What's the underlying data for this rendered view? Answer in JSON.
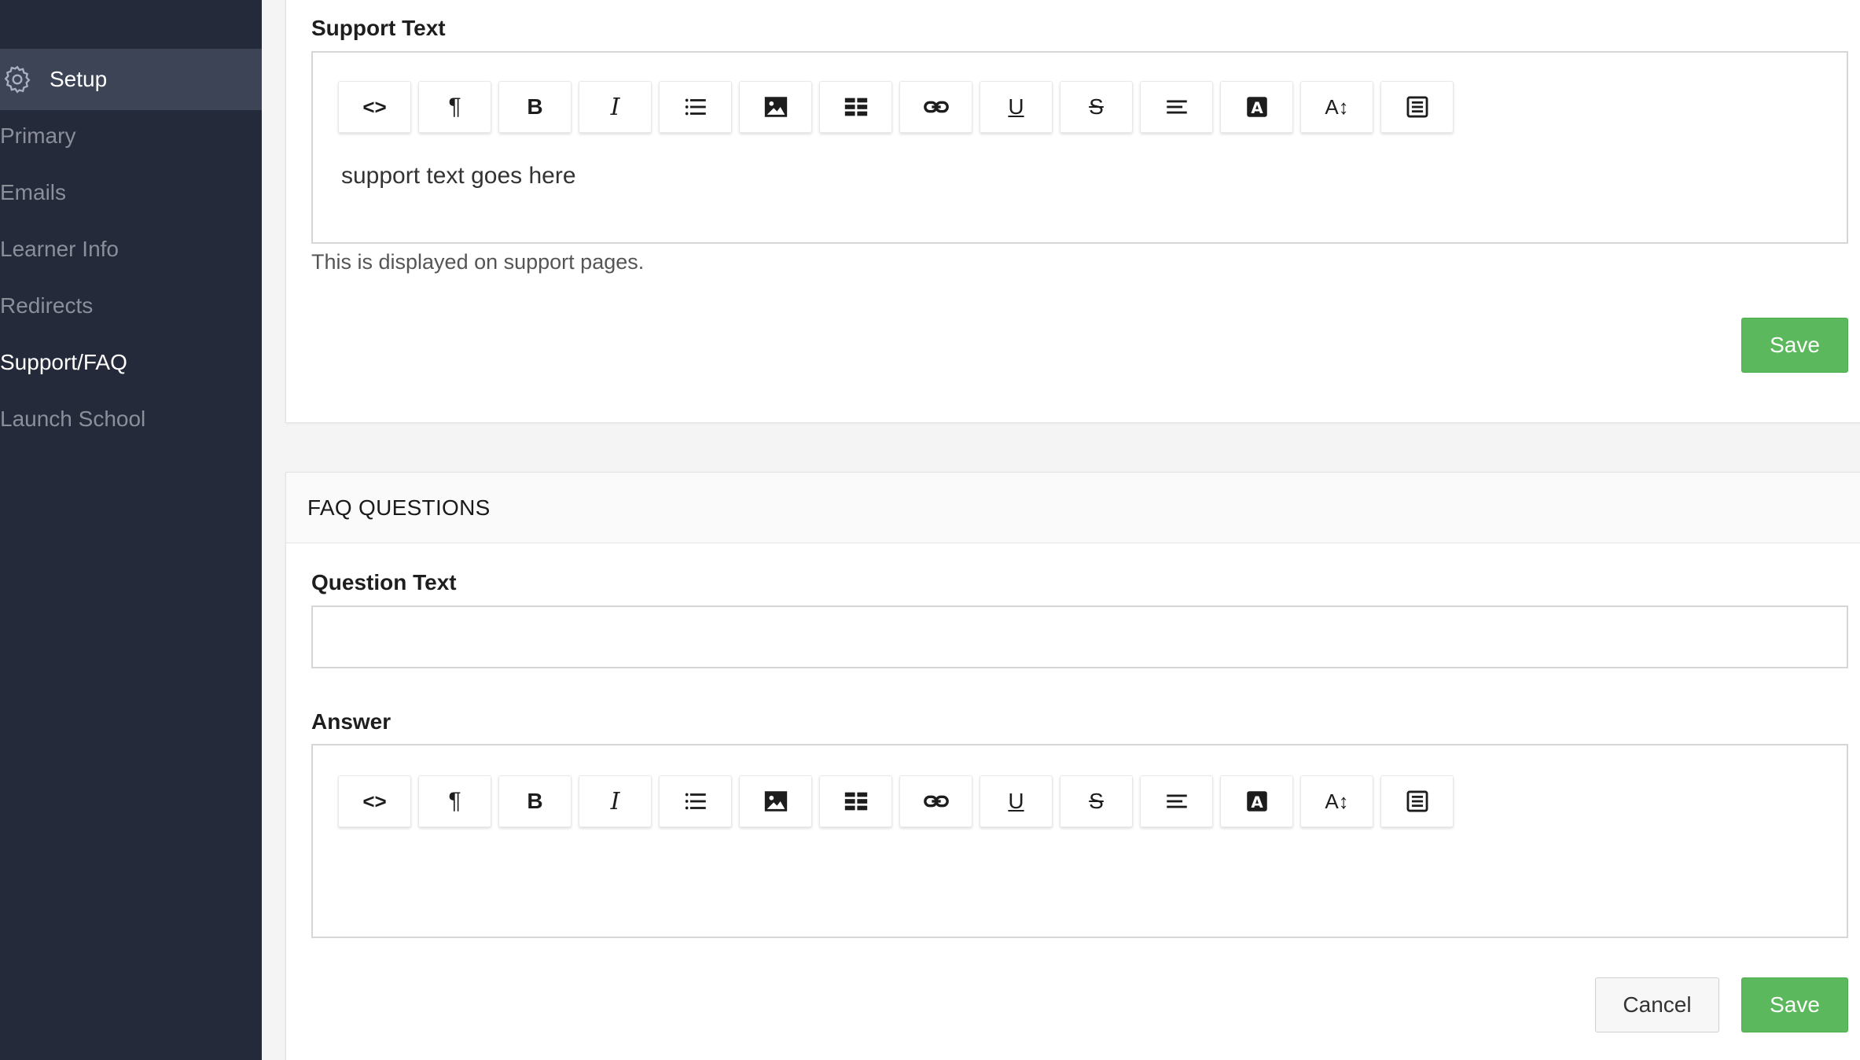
{
  "sidebar": {
    "setup_label": "Setup",
    "items": [
      {
        "label": "Primary",
        "active": false
      },
      {
        "label": "Emails",
        "active": false
      },
      {
        "label": "Learner Info",
        "active": false
      },
      {
        "label": "Redirects",
        "active": false
      },
      {
        "label": "Support/FAQ",
        "active": true
      },
      {
        "label": "Launch School",
        "active": false
      }
    ]
  },
  "support_card": {
    "label": "Support Text",
    "editor_content": "support text goes here",
    "help_text": "This is displayed on support pages.",
    "save_label": "Save"
  },
  "faq_card": {
    "title": "FAQ QUESTIONS",
    "question_label": "Question Text",
    "question_value": "",
    "answer_label": "Answer",
    "answer_content": "",
    "cancel_label": "Cancel",
    "save_label": "Save"
  },
  "toolbar": {
    "buttons": [
      "code-view",
      "paragraph",
      "bold",
      "italic",
      "list",
      "image",
      "table",
      "link",
      "underline",
      "strikethrough",
      "align",
      "font-color",
      "font-size",
      "template"
    ]
  },
  "colors": {
    "sidebar_bg": "#242a3a",
    "sidebar_active_bg": "#3c4456",
    "save_green": "#5cb85c"
  }
}
